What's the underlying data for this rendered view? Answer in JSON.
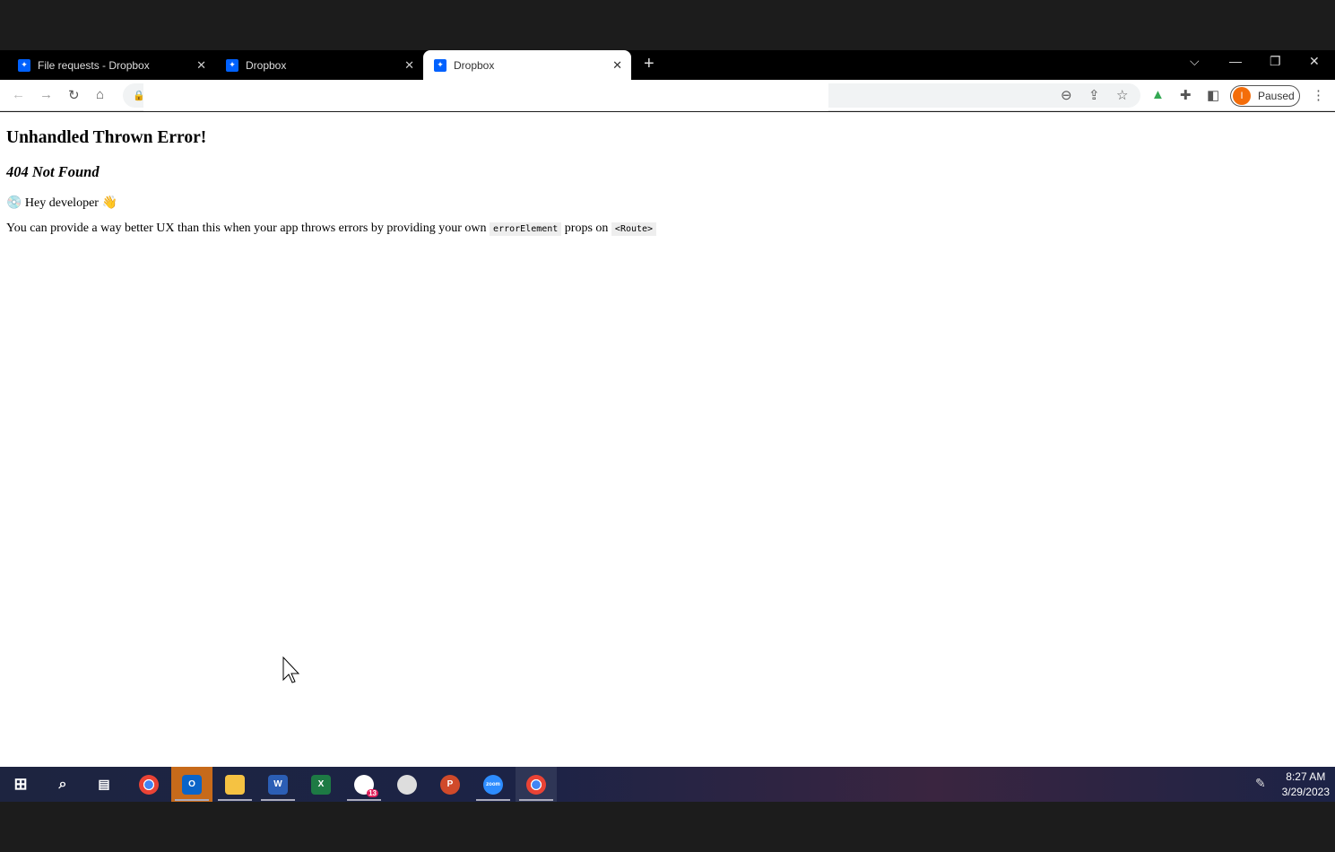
{
  "browser": {
    "tabs": [
      {
        "title": "File requests - Dropbox",
        "active": false
      },
      {
        "title": "Dropbox",
        "active": false
      },
      {
        "title": "Dropbox",
        "active": true
      }
    ],
    "profile": {
      "initial": "I",
      "status": "Paused",
      "color": "#f46d0a"
    }
  },
  "page": {
    "heading": "Unhandled Thrown Error!",
    "subheading": "404 Not Found",
    "hey": "💿 Hey developer 👋",
    "msg_pre": "You can provide a way better UX than this when your app throws errors by providing your own",
    "code1": "errorElement",
    "msg_mid": "props on",
    "code2": "<Route>"
  },
  "taskbar": {
    "apps": [
      "start",
      "search",
      "task-view",
      "chrome",
      "outlook",
      "file-explorer",
      "word",
      "excel",
      "slack",
      "paint",
      "powerpoint",
      "zoom",
      "chrome-profile"
    ],
    "slack_badge": "13",
    "time": "8:27 AM",
    "date": "3/29/2023"
  }
}
